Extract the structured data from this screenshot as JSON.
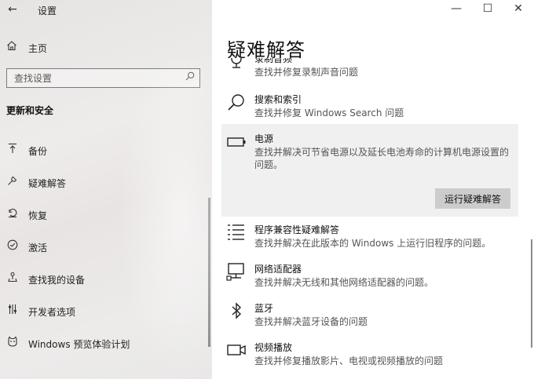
{
  "window": {
    "title": "设置",
    "back_glyph": "←",
    "minimize_glyph": "—",
    "maximize_glyph": "☐",
    "close_glyph": "✕"
  },
  "sidebar": {
    "home_label": "主页",
    "search_placeholder": "查找设置",
    "section_title": "更新和安全",
    "items": [
      {
        "label": "备份",
        "icon": "backup-arrow-icon"
      },
      {
        "label": "疑难解答",
        "icon": "wrench-icon"
      },
      {
        "label": "恢复",
        "icon": "recovery-icon"
      },
      {
        "label": "激活",
        "icon": "check-circle-icon"
      },
      {
        "label": "查找我的设备",
        "icon": "person-pin-icon"
      },
      {
        "label": "开发者选项",
        "icon": "developer-sliders-icon"
      },
      {
        "label": "Windows 预览体验计划",
        "icon": "insider-cat-icon"
      }
    ]
  },
  "main": {
    "title": "疑难解答",
    "items": [
      {
        "name": "录制音频",
        "desc": "查找并修复录制声音问题",
        "icon": "microphone-icon"
      },
      {
        "name": "搜索和索引",
        "desc": "查找并修复 Windows Search 问题",
        "icon": "search-icon"
      },
      {
        "name": "电源",
        "desc": "查找并解决可节省电源以及延长电池寿命的计算机电源设置的问题。",
        "icon": "battery-icon",
        "button": "运行疑难解答"
      },
      {
        "name": "程序兼容性疑难解答",
        "desc": "查找并解决在此版本的 Windows 上运行旧程序的问题。",
        "icon": "list-icon"
      },
      {
        "name": "网络适配器",
        "desc": "查找并解决无线和其他网络适配器的问题。",
        "icon": "network-adapter-icon"
      },
      {
        "name": "蓝牙",
        "desc": "查找并解决蓝牙设备的问题",
        "icon": "bluetooth-icon"
      },
      {
        "name": "视频播放",
        "desc": "查找并修复播放影片、电视或视频播放的问题",
        "icon": "video-camera-icon"
      }
    ]
  }
}
